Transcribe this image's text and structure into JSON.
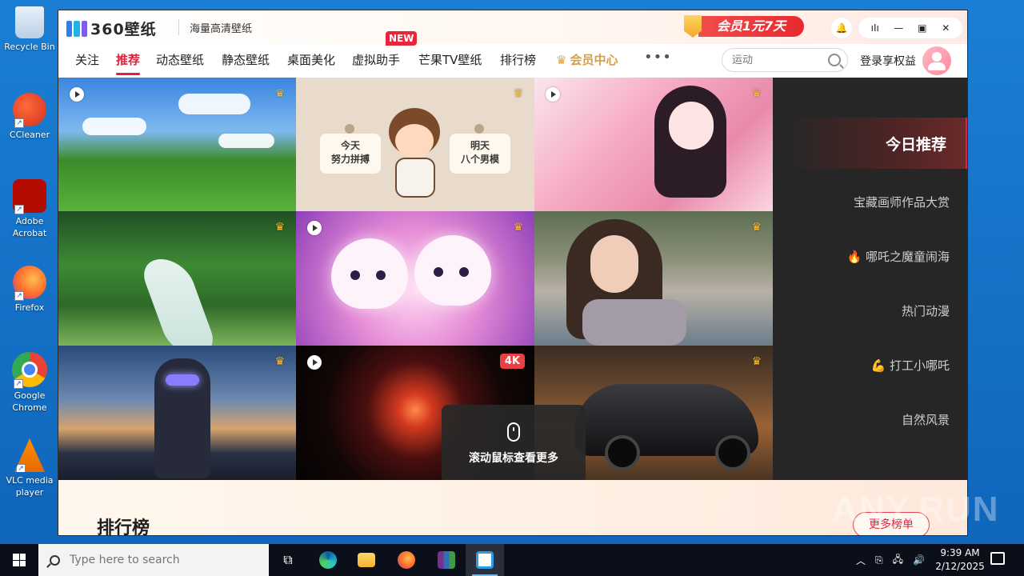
{
  "desktop": {
    "icons": [
      {
        "label": "Recycle Bin"
      },
      {
        "label": "CCleaner"
      },
      {
        "label": "Adobe Acrobat"
      },
      {
        "label": "Firefox"
      },
      {
        "label": "Google Chrome"
      },
      {
        "label": "VLC media player"
      }
    ]
  },
  "app": {
    "logo_text": "360壁纸",
    "slogan": "海量高清壁纸",
    "promo_text": "会员1元7天",
    "window_controls": [
      "bell-icon",
      "audio-icon",
      "minimize-icon",
      "maximize-icon",
      "close-icon"
    ],
    "nav": {
      "items": [
        "关注",
        "推荐",
        "动态壁纸",
        "静态壁纸",
        "桌面美化",
        "虚拟助手",
        "芒果TV壁纸",
        "排行榜"
      ],
      "active": "推荐",
      "new_tag": "NEW",
      "vip_label": "会员中心",
      "more": "•••"
    },
    "search": {
      "placeholder": "运动"
    },
    "login_label": "登录享权益",
    "tiles": [
      {
        "name": "meadow",
        "video": true,
        "vip": true
      },
      {
        "name": "cartoon-boy",
        "video": false,
        "vip": true,
        "card_left": "今天\n努力拼搏",
        "card_right": "明天\n八个男模"
      },
      {
        "name": "anime-girl",
        "video": true,
        "vip": true
      },
      {
        "name": "forest-stream",
        "video": false,
        "vip": true
      },
      {
        "name": "white-puppies",
        "video": true,
        "vip": true
      },
      {
        "name": "girl-portrait",
        "video": false,
        "vip": true
      },
      {
        "name": "cyber-girl",
        "video": false,
        "vip": true
      },
      {
        "name": "red-vortex",
        "video": true,
        "badge": "4K"
      },
      {
        "name": "black-sports-car",
        "video": false,
        "vip": true
      }
    ],
    "card_left": "今天",
    "card_left_2": "努力拼搏",
    "card_right": "明天",
    "card_right_2": "八个男模",
    "badge_4k": "4K",
    "categories": [
      "今日推荐",
      "宝藏画师作品大赏",
      "哪吒之魔童闹海",
      "热门动漫",
      "打工小哪吒",
      "自然风景"
    ],
    "scroll_tip": "滚动鼠标查看更多",
    "rank_title": "排行榜",
    "more_rank": "更多榜单"
  },
  "watermark": "ANY.RUN",
  "taskbar": {
    "search_placeholder": "Type here to search",
    "time": "9:39 AM",
    "date": "2/12/2025"
  },
  "colors": {
    "accent": "#e3213b",
    "vip_gold": "#d4a04a",
    "side_panel": "#262626"
  }
}
